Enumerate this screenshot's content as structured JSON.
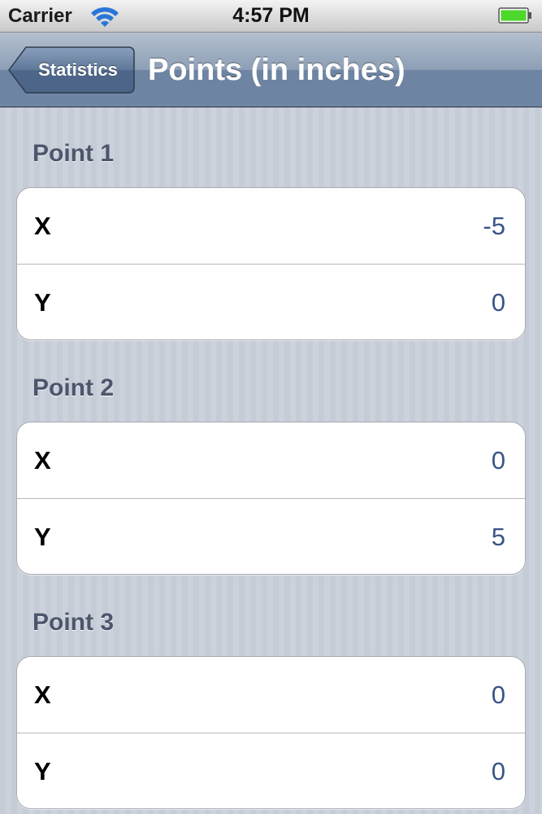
{
  "status_bar": {
    "carrier": "Carrier",
    "time": "4:57 PM",
    "wifi_icon": "wifi-icon",
    "battery_icon": "battery-icon",
    "battery_level": 1.0
  },
  "nav": {
    "back_label": "Statistics",
    "title": "Points (in inches)"
  },
  "sections": [
    {
      "header": "Point 1",
      "rows": [
        {
          "label": "X",
          "value": "-5"
        },
        {
          "label": "Y",
          "value": "0"
        }
      ]
    },
    {
      "header": "Point 2",
      "rows": [
        {
          "label": "X",
          "value": "0"
        },
        {
          "label": "Y",
          "value": "5"
        }
      ]
    },
    {
      "header": "Point 3",
      "rows": [
        {
          "label": "X",
          "value": "0"
        },
        {
          "label": "Y",
          "value": "0"
        }
      ]
    }
  ],
  "colors": {
    "value_text": "#385487",
    "section_header": "#4c566c",
    "battery_fill": "#4cd92c"
  }
}
